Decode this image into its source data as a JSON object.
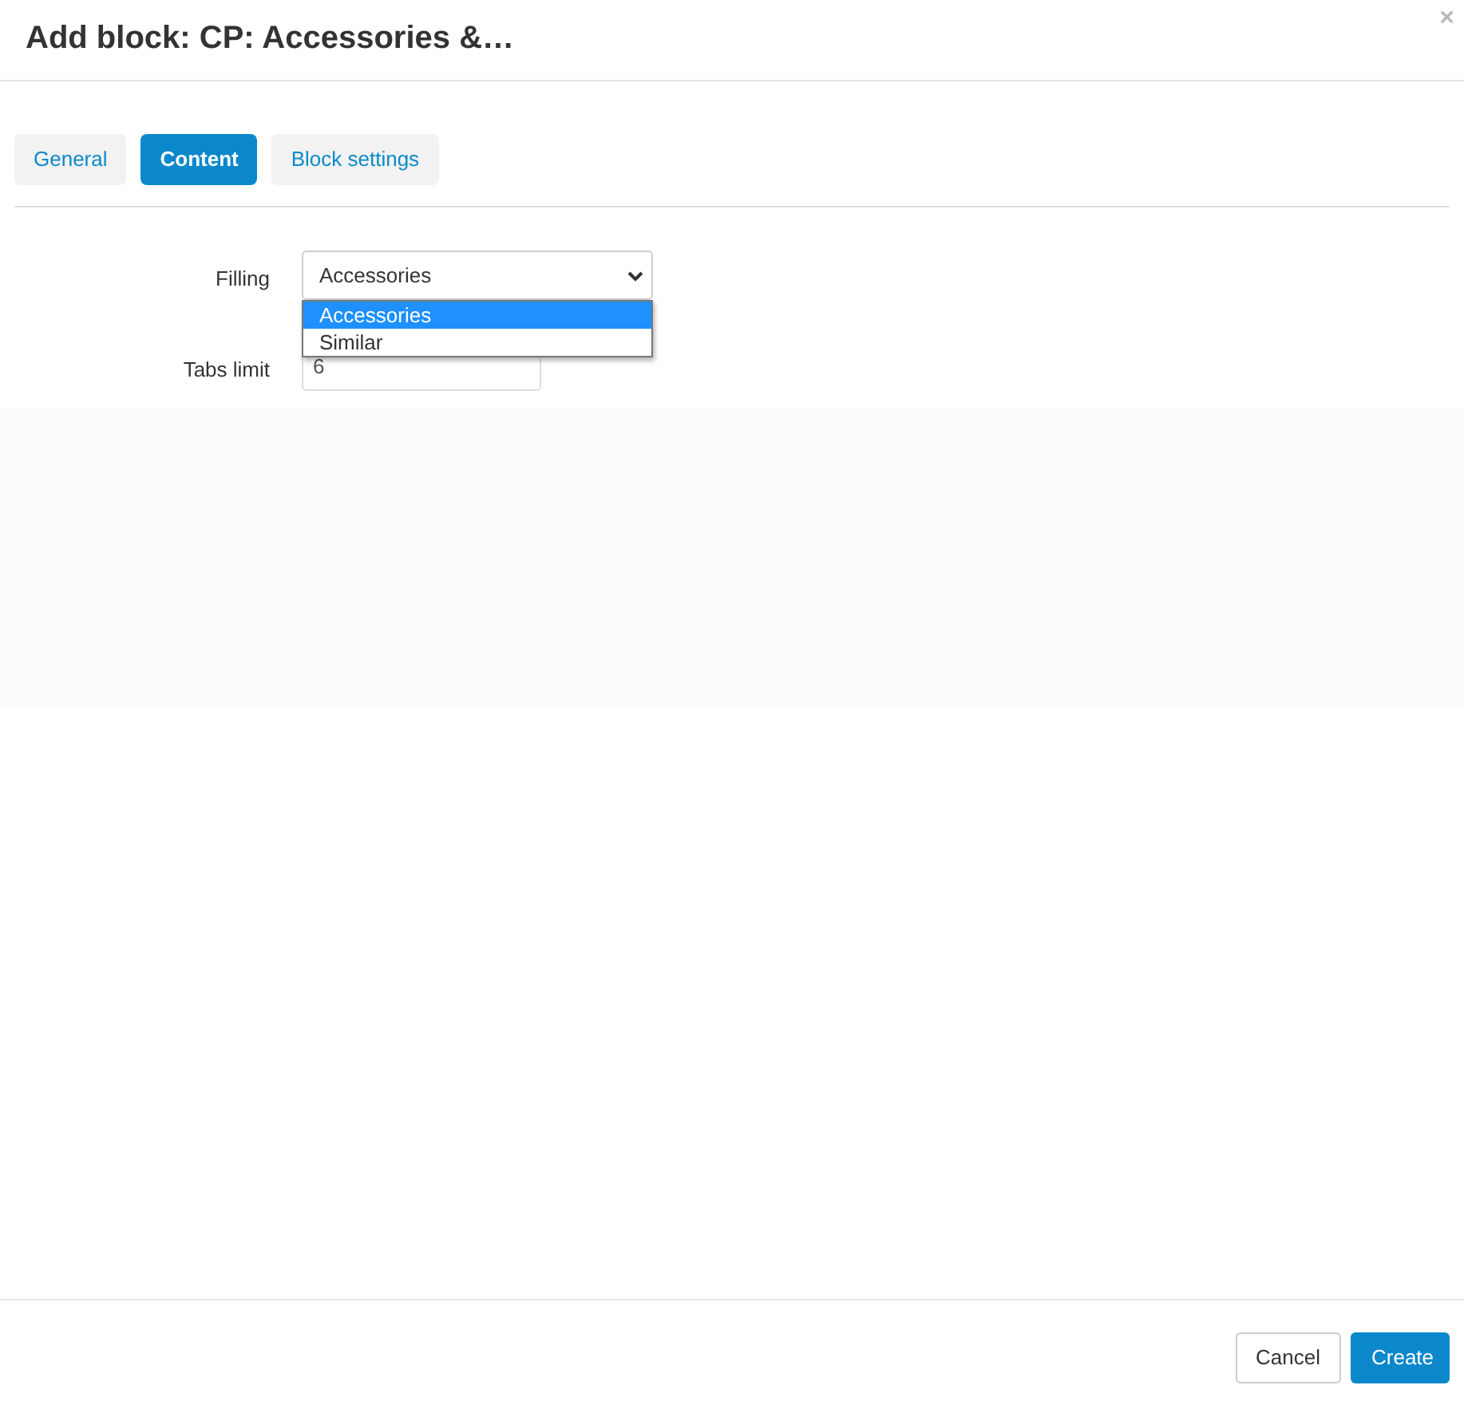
{
  "dialog": {
    "title": "Add block: CP: Accessories &…",
    "close": "×"
  },
  "tabs": [
    {
      "label": "General",
      "selected": false
    },
    {
      "label": "Content",
      "selected": true
    },
    {
      "label": "Block settings",
      "selected": false
    }
  ],
  "fields": [
    {
      "kind": "select",
      "label": "Filling",
      "value": "Accessories",
      "options": [
        {
          "label": "Accessories",
          "selected": true
        },
        {
          "label": "Similar",
          "selected": false
        }
      ]
    },
    {
      "kind": "input",
      "label": "Tabs limit",
      "value": "6"
    }
  ],
  "buttons": [
    {
      "label": "Cancel",
      "kind": "secondary"
    },
    {
      "label": "Create",
      "kind": "primary"
    }
  ]
}
